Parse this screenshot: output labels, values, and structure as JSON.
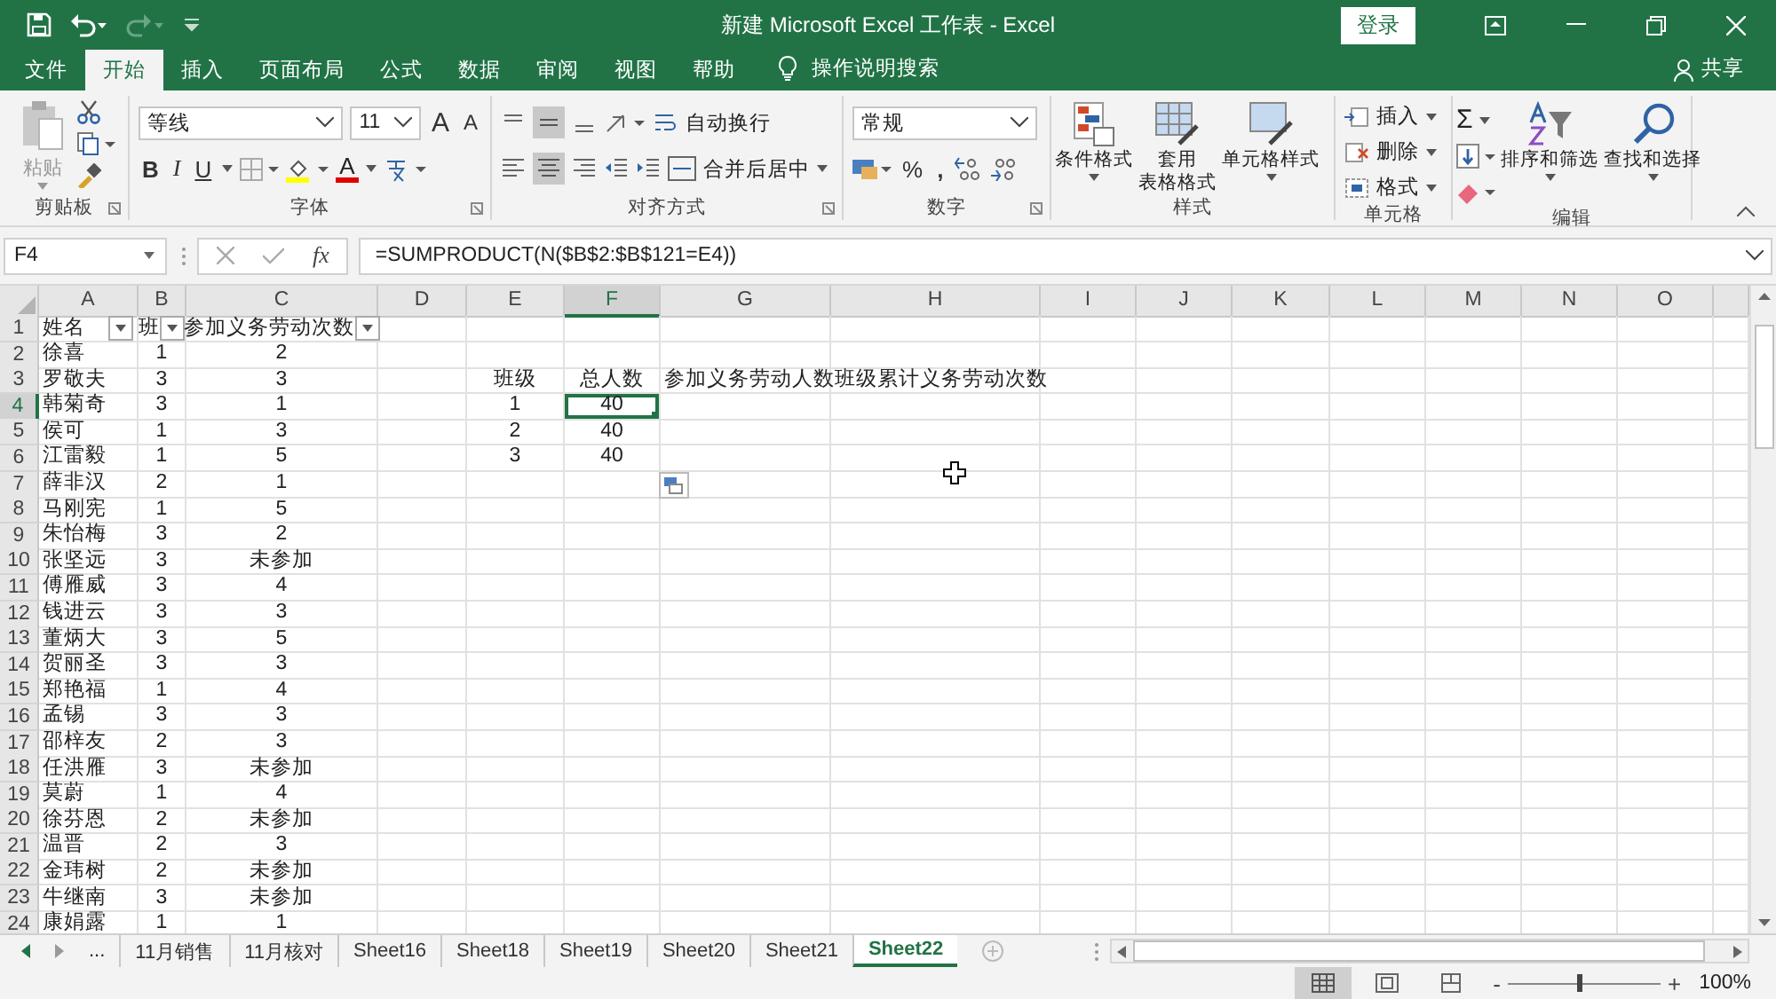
{
  "title_bar": {
    "title": "新建 Microsoft Excel 工作表  -  Excel",
    "sign_in": "登录"
  },
  "ribbon_tabs": [
    {
      "label": "文件",
      "selected": false
    },
    {
      "label": "开始",
      "selected": true
    },
    {
      "label": "插入",
      "selected": false
    },
    {
      "label": "页面布局",
      "selected": false
    },
    {
      "label": "公式",
      "selected": false
    },
    {
      "label": "数据",
      "selected": false
    },
    {
      "label": "审阅",
      "selected": false
    },
    {
      "label": "视图",
      "selected": false
    },
    {
      "label": "帮助",
      "selected": false
    }
  ],
  "tell_me": "操作说明搜索",
  "share": "共享",
  "ribbon": {
    "clipboard": {
      "paste": "粘贴",
      "label": "剪贴板"
    },
    "font": {
      "name": "等线",
      "size": "11",
      "grow": "A",
      "shrink": "A",
      "bold": "B",
      "italic": "I",
      "underline": "U",
      "font_color": "A",
      "label": "字体"
    },
    "alignment": {
      "wrap": "自动换行",
      "merge": "合并后居中",
      "label": "对齐方式"
    },
    "number": {
      "format": "常规",
      "percent": "%",
      "comma": ",",
      "label": "数字"
    },
    "styles": {
      "conditional": "条件格式",
      "table_line1": "套用",
      "table_line2": "表格格式",
      "cell_styles": "单元格样式",
      "label": "样式"
    },
    "cells": {
      "insert": "插入",
      "delete": "删除",
      "format": "格式",
      "label": "单元格"
    },
    "editing": {
      "sum": "Σ",
      "sort": "排序和筛选",
      "find": "查找和选择",
      "label": "编辑"
    }
  },
  "formula_bar": {
    "name_box": "F4",
    "function_label": "fx",
    "formula": "=SUMPRODUCT(N($B$2:$B$121=E4))"
  },
  "sheet": {
    "columns": [
      {
        "label": "A",
        "selected": false
      },
      {
        "label": "B",
        "selected": false
      },
      {
        "label": "C",
        "selected": false
      },
      {
        "label": "D",
        "selected": false
      },
      {
        "label": "E",
        "selected": false
      },
      {
        "label": "F",
        "selected": true
      },
      {
        "label": "G",
        "selected": false
      },
      {
        "label": "H",
        "selected": false
      },
      {
        "label": "I",
        "selected": false
      },
      {
        "label": "J",
        "selected": false
      },
      {
        "label": "K",
        "selected": false
      },
      {
        "label": "L",
        "selected": false
      },
      {
        "label": "M",
        "selected": false
      },
      {
        "label": "N",
        "selected": false
      },
      {
        "label": "O",
        "selected": false
      }
    ],
    "rows": [
      {
        "number": "1",
        "selected": false,
        "cells": {
          "A": {
            "text": "姓名",
            "filter": true,
            "selected": false
          },
          "B": {
            "text": "班",
            "filter": true,
            "selected": false
          },
          "C": {
            "text": "参加义务劳动次数",
            "filter": true,
            "selected": false
          }
        }
      },
      {
        "number": "2",
        "selected": false,
        "cells": {
          "A": {
            "text": "徐喜",
            "selected": false
          },
          "B": {
            "text": "1",
            "selected": false
          },
          "C": {
            "text": "2",
            "selected": false
          }
        }
      },
      {
        "number": "3",
        "selected": false,
        "cells": {
          "A": {
            "text": "罗敬夫",
            "selected": false
          },
          "B": {
            "text": "3",
            "selected": false
          },
          "C": {
            "text": "3",
            "selected": false
          },
          "E": {
            "text": "班级",
            "selected": false
          },
          "F": {
            "text": "总人数",
            "selected": false
          },
          "G": {
            "text": "参加义务劳动人数",
            "selected": false
          },
          "H": {
            "text": "班级累计义务劳动次数",
            "selected": false
          }
        }
      },
      {
        "number": "4",
        "selected": true,
        "cells": {
          "A": {
            "text": "韩菊奇",
            "selected": false
          },
          "B": {
            "text": "3",
            "selected": false
          },
          "C": {
            "text": "1",
            "selected": false
          },
          "E": {
            "text": "1",
            "selected": false
          },
          "F": {
            "text": "40",
            "selected": true
          }
        }
      },
      {
        "number": "5",
        "selected": false,
        "cells": {
          "A": {
            "text": "侯可",
            "selected": false
          },
          "B": {
            "text": "1",
            "selected": false
          },
          "C": {
            "text": "3",
            "selected": false
          },
          "E": {
            "text": "2",
            "selected": false
          },
          "F": {
            "text": "40",
            "selected": false
          }
        }
      },
      {
        "number": "6",
        "selected": false,
        "cells": {
          "A": {
            "text": "江雷毅",
            "selected": false
          },
          "B": {
            "text": "1",
            "selected": false
          },
          "C": {
            "text": "5",
            "selected": false
          },
          "E": {
            "text": "3",
            "selected": false
          },
          "F": {
            "text": "40",
            "selected": false
          }
        }
      },
      {
        "number": "7",
        "selected": false,
        "cells": {
          "A": {
            "text": "薛非汉",
            "selected": false
          },
          "B": {
            "text": "2",
            "selected": false
          },
          "C": {
            "text": "1",
            "selected": false
          }
        }
      },
      {
        "number": "8",
        "selected": false,
        "cells": {
          "A": {
            "text": "马刚宪",
            "selected": false
          },
          "B": {
            "text": "1",
            "selected": false
          },
          "C": {
            "text": "5",
            "selected": false
          }
        }
      },
      {
        "number": "9",
        "selected": false,
        "cells": {
          "A": {
            "text": "朱怡梅",
            "selected": false
          },
          "B": {
            "text": "3",
            "selected": false
          },
          "C": {
            "text": "2",
            "selected": false
          }
        }
      },
      {
        "number": "10",
        "selected": false,
        "cells": {
          "A": {
            "text": "张坚远",
            "selected": false
          },
          "B": {
            "text": "3",
            "selected": false
          },
          "C": {
            "text": "未参加",
            "selected": false
          }
        }
      },
      {
        "number": "11",
        "selected": false,
        "cells": {
          "A": {
            "text": "傅雁威",
            "selected": false
          },
          "B": {
            "text": "3",
            "selected": false
          },
          "C": {
            "text": "4",
            "selected": false
          }
        }
      },
      {
        "number": "12",
        "selected": false,
        "cells": {
          "A": {
            "text": "钱进云",
            "selected": false
          },
          "B": {
            "text": "3",
            "selected": false
          },
          "C": {
            "text": "3",
            "selected": false
          }
        }
      },
      {
        "number": "13",
        "selected": false,
        "cells": {
          "A": {
            "text": "董炳大",
            "selected": false
          },
          "B": {
            "text": "3",
            "selected": false
          },
          "C": {
            "text": "5",
            "selected": false
          }
        }
      },
      {
        "number": "14",
        "selected": false,
        "cells": {
          "A": {
            "text": "贺丽圣",
            "selected": false
          },
          "B": {
            "text": "3",
            "selected": false
          },
          "C": {
            "text": "3",
            "selected": false
          }
        }
      },
      {
        "number": "15",
        "selected": false,
        "cells": {
          "A": {
            "text": "郑艳福",
            "selected": false
          },
          "B": {
            "text": "1",
            "selected": false
          },
          "C": {
            "text": "4",
            "selected": false
          }
        }
      },
      {
        "number": "16",
        "selected": false,
        "cells": {
          "A": {
            "text": "孟锡",
            "selected": false
          },
          "B": {
            "text": "3",
            "selected": false
          },
          "C": {
            "text": "3",
            "selected": false
          }
        }
      },
      {
        "number": "17",
        "selected": false,
        "cells": {
          "A": {
            "text": "邵梓友",
            "selected": false
          },
          "B": {
            "text": "2",
            "selected": false
          },
          "C": {
            "text": "3",
            "selected": false
          }
        }
      },
      {
        "number": "18",
        "selected": false,
        "cells": {
          "A": {
            "text": "任洪雁",
            "selected": false
          },
          "B": {
            "text": "3",
            "selected": false
          },
          "C": {
            "text": "未参加",
            "selected": false
          }
        }
      },
      {
        "number": "19",
        "selected": false,
        "cells": {
          "A": {
            "text": "莫蔚",
            "selected": false
          },
          "B": {
            "text": "1",
            "selected": false
          },
          "C": {
            "text": "4",
            "selected": false
          }
        }
      },
      {
        "number": "20",
        "selected": false,
        "cells": {
          "A": {
            "text": "徐芬恩",
            "selected": false
          },
          "B": {
            "text": "2",
            "selected": false
          },
          "C": {
            "text": "未参加",
            "selected": false
          }
        }
      },
      {
        "number": "21",
        "selected": false,
        "cells": {
          "A": {
            "text": "温晋",
            "selected": false
          },
          "B": {
            "text": "2",
            "selected": false
          },
          "C": {
            "text": "3",
            "selected": false
          }
        }
      },
      {
        "number": "22",
        "selected": false,
        "cells": {
          "A": {
            "text": "金玮树",
            "selected": false
          },
          "B": {
            "text": "2",
            "selected": false
          },
          "C": {
            "text": "未参加",
            "selected": false
          }
        }
      },
      {
        "number": "23",
        "selected": false,
        "cells": {
          "A": {
            "text": "牛继南",
            "selected": false
          },
          "B": {
            "text": "3",
            "selected": false
          },
          "C": {
            "text": "未参加",
            "selected": false
          }
        }
      },
      {
        "number": "24",
        "selected": false,
        "cells": {
          "A": {
            "text": "康娟露",
            "selected": false
          },
          "B": {
            "text": "1",
            "selected": false
          },
          "C": {
            "text": "1",
            "selected": false
          }
        }
      }
    ]
  },
  "sheet_tabs": {
    "more": "...",
    "tabs": [
      {
        "label": "11月销售",
        "selected": false
      },
      {
        "label": "11月核对",
        "selected": false
      },
      {
        "label": "Sheet16",
        "selected": false
      },
      {
        "label": "Sheet18",
        "selected": false
      },
      {
        "label": "Sheet19",
        "selected": false
      },
      {
        "label": "Sheet20",
        "selected": false
      },
      {
        "label": "Sheet21",
        "selected": false
      },
      {
        "label": "Sheet22",
        "selected": true
      }
    ]
  },
  "status_bar": {
    "zoom_out": "-",
    "zoom_in": "+",
    "zoom": "100%",
    "level": 0.47
  }
}
